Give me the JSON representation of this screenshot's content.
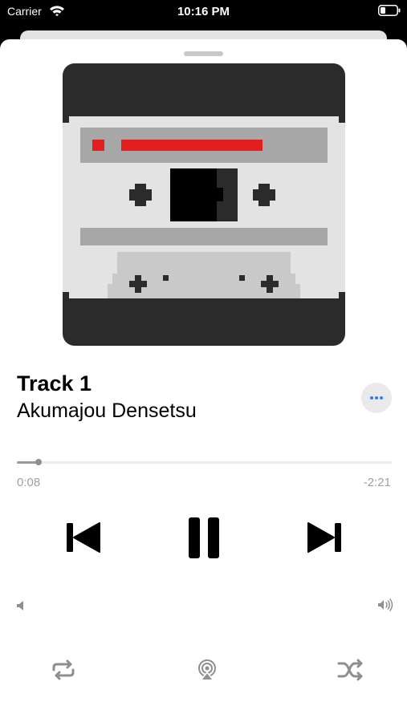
{
  "status_bar": {
    "carrier": "Carrier",
    "time": "10:16 PM",
    "wifi_icon": "wifi-icon",
    "battery_icon": "battery-icon"
  },
  "now_playing": {
    "title": "Track 1",
    "artist": "Akumajou Densetsu",
    "artwork": "cassette-tape-artwork",
    "elapsed": "0:08",
    "remaining": "-2:21",
    "progress_fraction": 0.057
  },
  "controls": {
    "previous_icon": "previous-track-icon",
    "pause_icon": "pause-icon",
    "next_icon": "next-track-icon",
    "more_icon": "ellipsis-icon",
    "volume_low_icon": "speaker-low-icon",
    "volume_high_icon": "speaker-high-icon",
    "repeat_icon": "repeat-icon",
    "airplay_icon": "airplay-audio-icon",
    "shuffle_icon": "shuffle-icon"
  },
  "colors": {
    "accent": "#2f7cf6",
    "artwork_dark": "#2b2b2b",
    "artwork_light": "#e3e3e3",
    "artwork_red": "#e21e1e"
  }
}
